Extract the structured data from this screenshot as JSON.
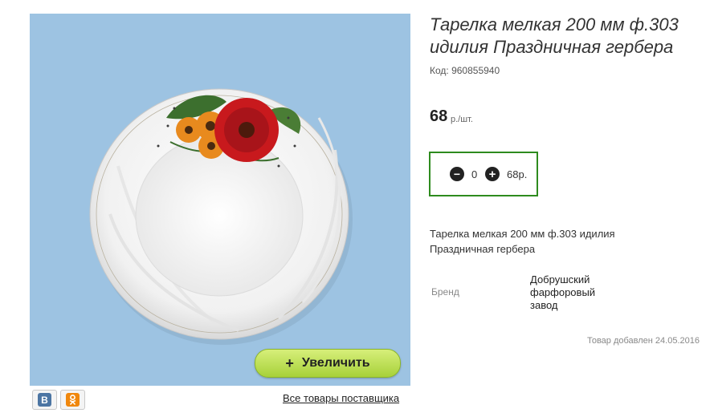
{
  "product": {
    "title": "Тарелка мелкая 200 мм ф.303 идилия Праздничная гербера",
    "code": "Код: 960855940",
    "price": "68",
    "price_unit": "р./шт.",
    "description": "Тарелка мелкая 200 мм ф.303 идилия Праздничная гербера",
    "brand_label": "Бренд",
    "brand_value": "Добрушский фарфоровый завод",
    "added_date": "Товар добавлен 24.05.2016"
  },
  "quantity": {
    "value": "0",
    "total": "68р.",
    "minus_icon": "minus-circle-icon",
    "plus_icon": "plus-circle-icon"
  },
  "image": {
    "zoom_plus": "+",
    "zoom_label": "Увеличить",
    "background_color": "#9dc3e2"
  },
  "social": {
    "vk_label": "B",
    "ok_label": "ок"
  },
  "links": {
    "supplier": "Все товары поставщика"
  },
  "colors": {
    "accent_border": "#2e8b1e",
    "zoom_button": "#a7d13a"
  }
}
